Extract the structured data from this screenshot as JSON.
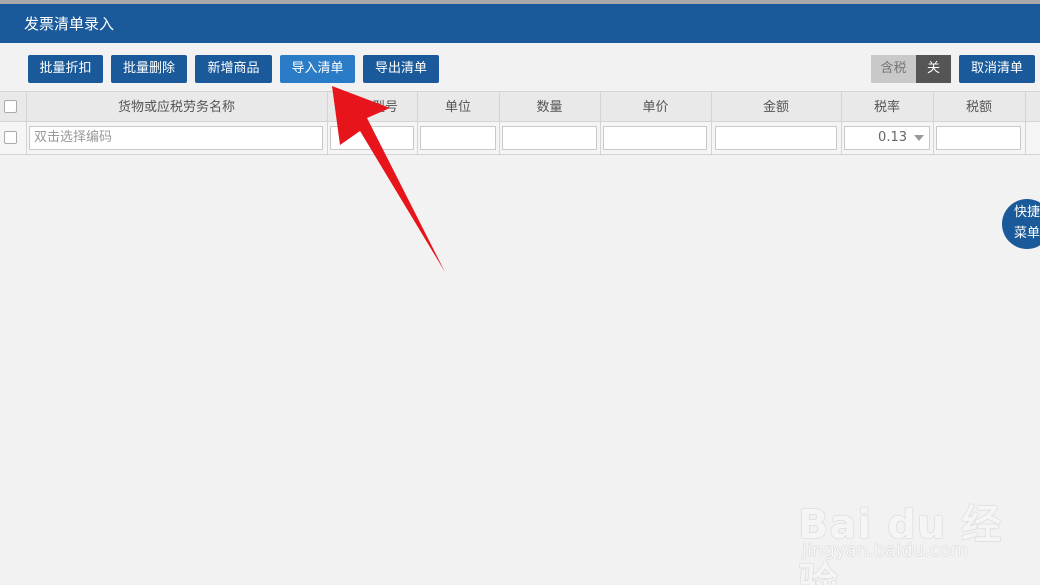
{
  "dialog": {
    "title": "发票清单录入"
  },
  "toolbar": {
    "batch_discount": "批量折扣",
    "batch_delete": "批量删除",
    "add_goods": "新增商品",
    "import_list": "导入清单",
    "export_list": "导出清单",
    "cancel_list": "取消清单",
    "tax_toggle": {
      "label": "含税",
      "state": "关"
    }
  },
  "table": {
    "columns": [
      "货物或应税劳务名称",
      "规格型号",
      "单位",
      "数量",
      "单价",
      "金额",
      "税率",
      "税额"
    ],
    "row": {
      "name_placeholder": "双击选择编码",
      "tax_rate": "0.13"
    }
  },
  "quick_menu": {
    "line1": "快捷",
    "line2": "菜单"
  },
  "watermark": {
    "logo": "Bai du 经验",
    "url": "jingyan.baidu.com"
  },
  "colors": {
    "primary": "#1a5a9a",
    "active_button": "#2a7cc6",
    "annotation_arrow": "#e8141b"
  },
  "icons": [
    "checkbox-icon",
    "dropdown-arrow-icon",
    "annotation-arrow-icon"
  ]
}
